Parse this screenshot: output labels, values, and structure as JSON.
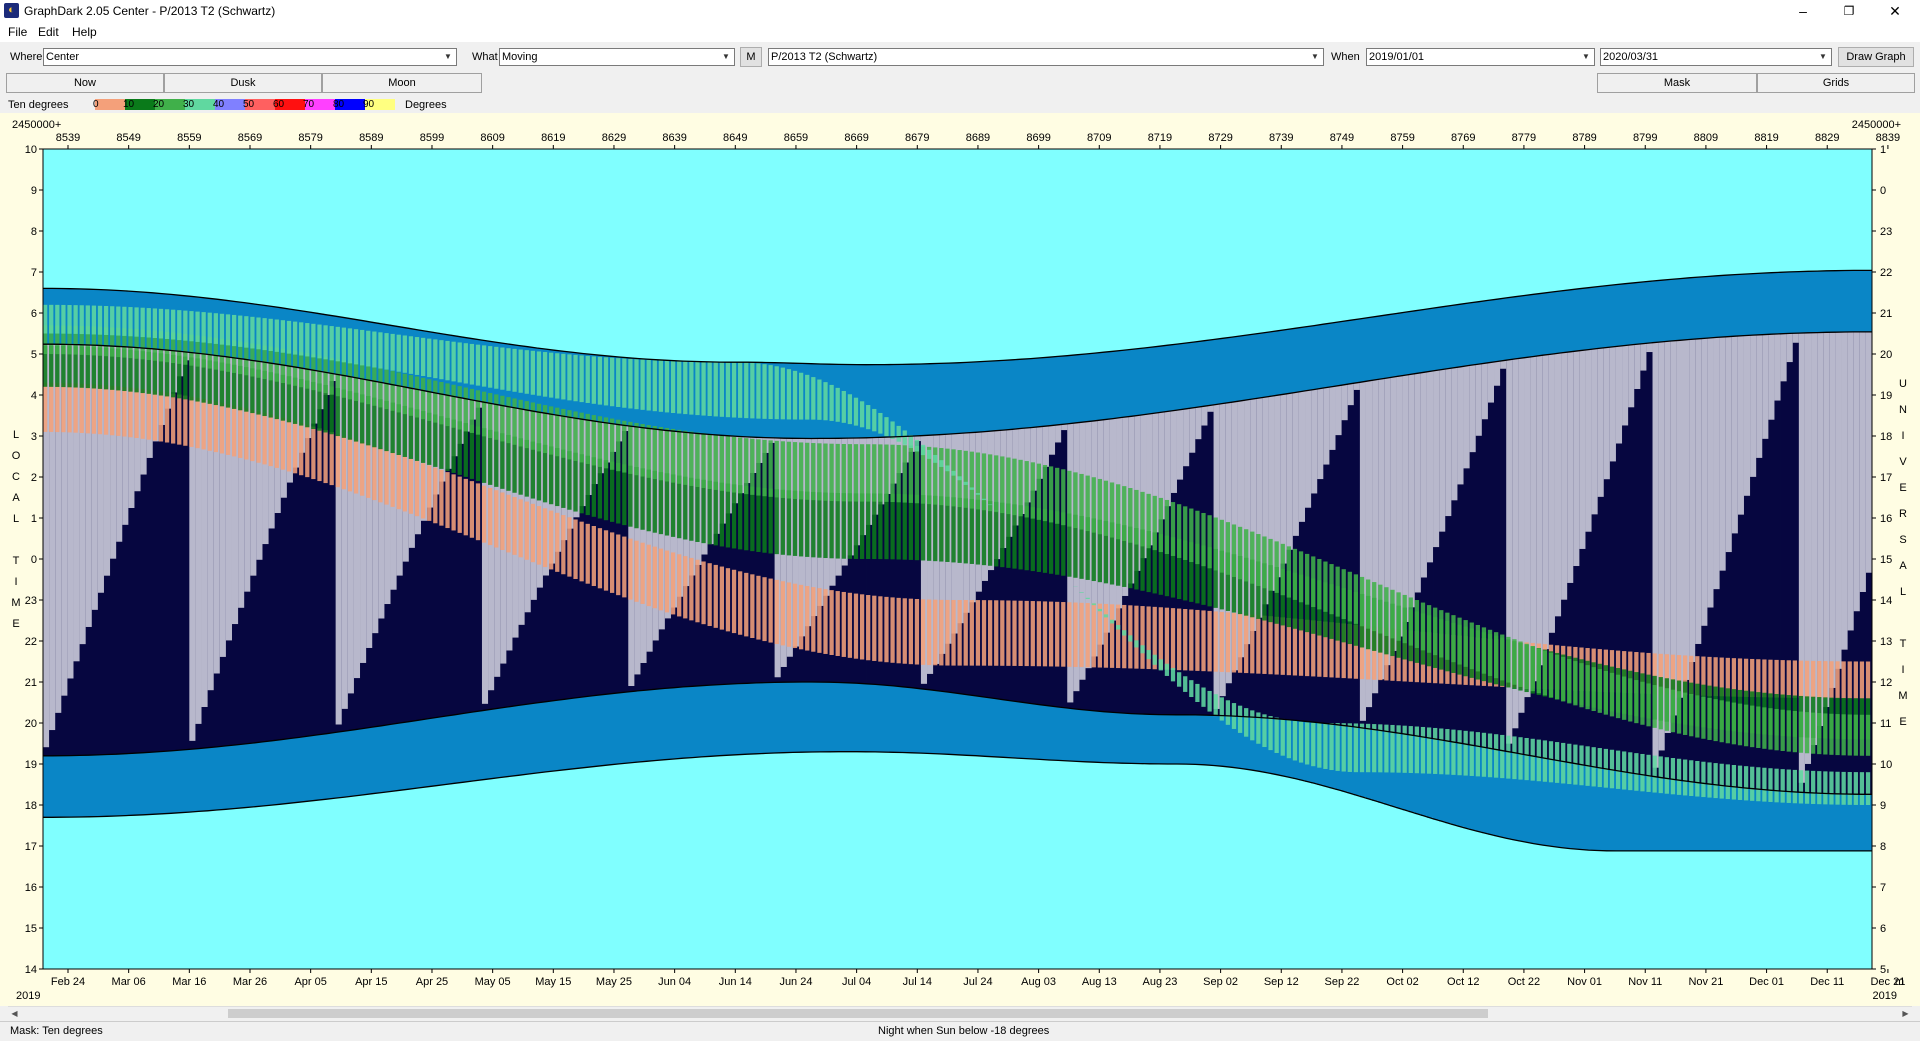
{
  "window": {
    "title": "GraphDark 2.05  Center  -  P/2013 T2 (Schwartz)"
  },
  "menu": [
    "File",
    "Edit",
    "Help"
  ],
  "toolbar": {
    "where_label": "Where",
    "where_value": "Center",
    "what_label": "What",
    "what_value": "Moving",
    "m_button": "M",
    "object_value": "P/2013 T2 (Schwartz)",
    "when_label": "When",
    "start_date": "2019/01/01",
    "end_date": "2020/03/31",
    "draw_button": "Draw Graph"
  },
  "tabs": {
    "now": "Now",
    "dusk": "Dusk",
    "moon": "Moon",
    "mask": "Mask",
    "grids": "Grids"
  },
  "legend": {
    "label": "Ten degrees",
    "unit": "Degrees",
    "bins": [
      {
        "num": "0",
        "color": "#f4a07a"
      },
      {
        "num": "10",
        "color": "#0a7a1a"
      },
      {
        "num": "20",
        "color": "#40b04a"
      },
      {
        "num": "30",
        "color": "#60d8a0"
      },
      {
        "num": "40",
        "color": "#8080ff"
      },
      {
        "num": "50",
        "color": "#ff6060"
      },
      {
        "num": "60",
        "color": "#ff1010"
      },
      {
        "num": "70",
        "color": "#ff40ff"
      },
      {
        "num": "80",
        "color": "#0000ff"
      },
      {
        "num": "90",
        "color": "#ffff80"
      }
    ]
  },
  "graph": {
    "jd_base_left": "2450000+",
    "jd_base_right": "2450000+",
    "jd_ticks": [
      "8539",
      "8549",
      "8559",
      "8569",
      "8579",
      "8589",
      "8599",
      "8609",
      "8619",
      "8629",
      "8639",
      "8649",
      "8659",
      "8669",
      "8679",
      "8689",
      "8699",
      "8709",
      "8719",
      "8729",
      "8739",
      "8749",
      "8759",
      "8769",
      "8779",
      "8789",
      "8799",
      "8809",
      "8819",
      "8829",
      "8839"
    ],
    "date_ticks": [
      "Feb 24",
      "Mar 06",
      "Mar 16",
      "Mar 26",
      "Apr 05",
      "Apr 15",
      "Apr 25",
      "May 05",
      "May 15",
      "May 25",
      "Jun 04",
      "Jun 14",
      "Jun 24",
      "Jul 04",
      "Jul 14",
      "Jul 24",
      "Aug 03",
      "Aug 13",
      "Aug 23",
      "Sep 02",
      "Sep 12",
      "Sep 22",
      "Oct 02",
      "Oct 12",
      "Oct 22",
      "Nov 01",
      "Nov 11",
      "Nov 21",
      "Dec 01",
      "Dec 11",
      "Dec 21"
    ],
    "year_left": "2019",
    "year_right": "2019",
    "right_corner_label": "m",
    "left_axis_ticks": [
      "10",
      "9",
      "8",
      "7",
      "6",
      "5",
      "4",
      "3",
      "2",
      "1",
      "0",
      "23",
      "22",
      "21",
      "20",
      "19",
      "18",
      "17",
      "16",
      "15",
      "14"
    ],
    "right_axis_ticks": [
      "1",
      "0",
      "23",
      "22",
      "21",
      "20",
      "19",
      "18",
      "17",
      "16",
      "15",
      "14",
      "13",
      "12",
      "11",
      "10",
      "9",
      "8",
      "7",
      "6",
      "5"
    ],
    "left_axis_title": [
      "L",
      "O",
      "C",
      "A",
      "L",
      "",
      "T",
      "I",
      "M",
      "E"
    ],
    "right_axis_title": [
      "U",
      "N",
      "I",
      "V",
      "E",
      "R",
      "S",
      "A",
      "L",
      "",
      "T",
      "I",
      "M",
      "E"
    ]
  },
  "colors": {
    "day": "#80ffff",
    "twilight": "#0a86c6",
    "night": "#060640",
    "moon": "#c8c8d8",
    "alt_0": "#f4a07a",
    "alt_10": "#0a7a1a",
    "alt_20": "#40b04a",
    "alt_30": "#60d8a0",
    "alt_40": "#8080ff"
  },
  "status": {
    "mask": "Mask:  Ten degrees",
    "night": "Night when Sun below -18 degrees"
  }
}
